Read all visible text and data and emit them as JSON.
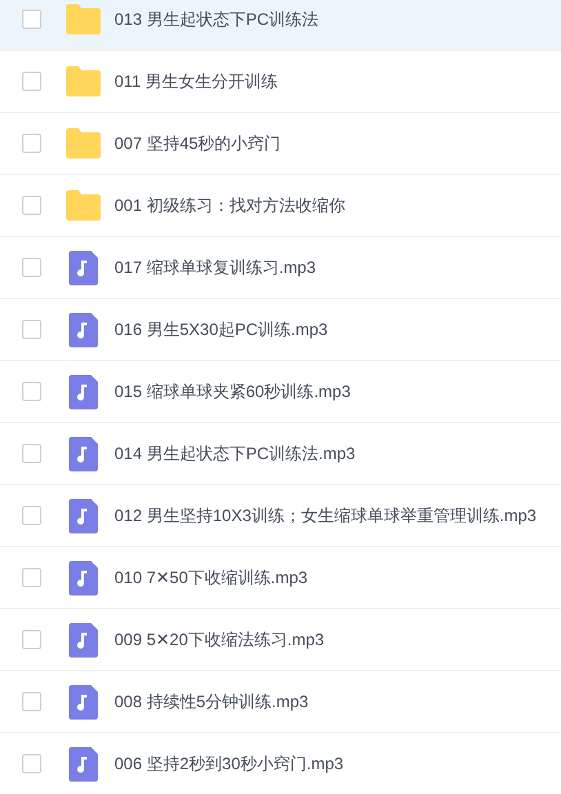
{
  "files": [
    {
      "kind": "folder",
      "name": "013 男生起状态下PC训练法",
      "checked": false,
      "hovered": true
    },
    {
      "kind": "folder",
      "name": "011 男生女生分开训练",
      "checked": false,
      "hovered": false
    },
    {
      "kind": "folder",
      "name": "007 坚持45秒的小窍门",
      "checked": false,
      "hovered": false
    },
    {
      "kind": "folder",
      "name": "001 初级练习：找对方法收缩你",
      "checked": false,
      "hovered": false
    },
    {
      "kind": "audio",
      "name": "017 缩球单球复训练习.mp3",
      "checked": false,
      "hovered": false
    },
    {
      "kind": "audio",
      "name": "016 男生5X30起PC训练.mp3",
      "checked": false,
      "hovered": false
    },
    {
      "kind": "audio",
      "name": "015 缩球单球夹紧60秒训练.mp3",
      "checked": false,
      "hovered": false
    },
    {
      "kind": "audio",
      "name": "014 男生起状态下PC训练法.mp3",
      "checked": false,
      "hovered": false
    },
    {
      "kind": "audio",
      "name": "012 男生坚持10X3训练；女生缩球单球举重管理训练.mp3",
      "checked": false,
      "hovered": false
    },
    {
      "kind": "audio",
      "name": "010 7✕50下收缩训练.mp3",
      "checked": false,
      "hovered": false
    },
    {
      "kind": "audio",
      "name": "009 5✕20下收缩法练习.mp3",
      "checked": false,
      "hovered": false
    },
    {
      "kind": "audio",
      "name": "008 持续性5分钟训练.mp3",
      "checked": false,
      "hovered": false
    },
    {
      "kind": "audio",
      "name": "006 坚持2秒到30秒小窍门.mp3",
      "checked": false,
      "hovered": false
    }
  ]
}
